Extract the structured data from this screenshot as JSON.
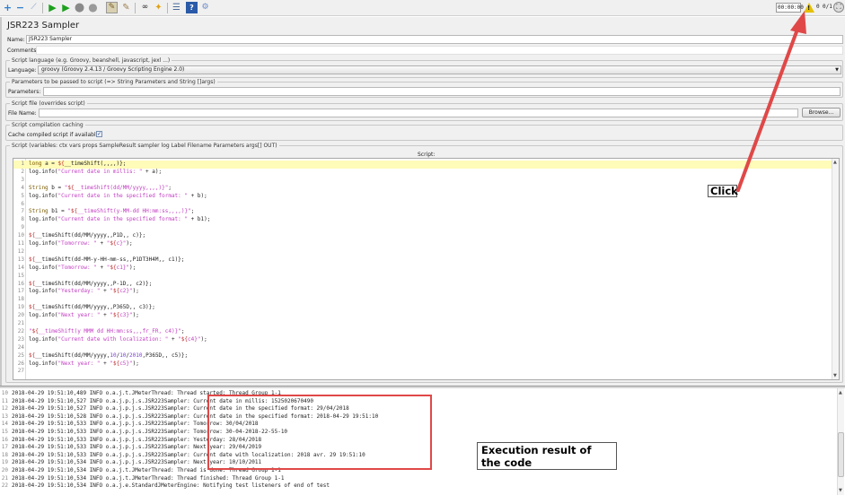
{
  "toolbar": {
    "icons": [
      "expand-all-icon",
      "collapse-all-icon",
      "toggle-icon",
      "start-icon",
      "start-no-pauses-icon",
      "stop-icon",
      "shutdown-icon",
      "clear-icon",
      "clear-all-icon",
      "search-icon",
      "reset-search-icon",
      "function-helper-icon",
      "help-icon",
      "remote-icon"
    ],
    "timer": "00:00:00",
    "error_count": "0",
    "threads": "0/1"
  },
  "panel": {
    "title": "JSR223 Sampler",
    "name_label": "Name:",
    "name_value": "JSR223 Sampler",
    "comments_label": "Comments:",
    "comments_value": "",
    "script_language_group": "Script language (e.g. Groovy, beanshell, javascript, jexl ...)",
    "language_label": "Language:",
    "language_value": "groovy     (Groovy 2.4.13 / Groovy Scripting Engine 2.0)",
    "parameters_group": "Parameters to be passed to script (=> String Parameters and String []args)",
    "parameters_label": "Parameters:",
    "parameters_value": "",
    "script_file_group": "Script file (overrides script)",
    "file_name_label": "File Name:",
    "file_name_value": "",
    "browse_label": "Browse...",
    "caching_group": "Script compilation caching",
    "cache_label": "Cache compiled script if available:",
    "cache_checked": true,
    "script_group": "Script (variables: ctx vars props SampleResult sampler log Label Filename Parameters args[] OUT)",
    "script_header": "Script:"
  },
  "script_lines": [
    "long a = ${__timeShift(,,,,)};",
    "log.info(\"Current date in millis: \" + a);",
    "",
    "String b = \"${__timeShift(dd/MM/yyyy,,,,)}\";",
    "log.info(\"Current date in the specified format: \" + b);",
    "",
    "String b1 = \"${__timeShift(y-MM-dd HH:mm:ss,,,,)}\";",
    "log.info(\"Current date in the specified format: \" + b1);",
    "",
    "${__timeShift(dd/MM/yyyy,,P1D,, c)};",
    "log.info(\"Tomorrow: \" + \"${c}\");",
    "",
    "${__timeShift(dd-MM-y-HH-mm-ss,,P1DT3H4M,, c1)};",
    "log.info(\"Tomorrow: \" + \"${c1}\");",
    "",
    "${__timeShift(dd/MM/yyyy,,P-1D,, c2)};",
    "log.info(\"Yesterday: \" + \"${c2}\");",
    "",
    "${__timeShift(dd/MM/yyyy,,P365D,, c3)};",
    "log.info(\"Next year: \" + \"${c3}\");",
    "",
    "\"${__timeShift(y MMM dd HH:mm:ss,,,fr_FR, c4)}\";",
    "log.info(\"Current date with localization: \" + \"${c4}\");",
    "",
    "${__timeShift(dd/MM/yyyy,10/10/2010,P365D,, c5)};",
    "log.info(\"Next year: \" + \"${c5}\");",
    ""
  ],
  "log": [
    {
      "n": "10",
      "text": "2018-04-29 19:51:10,489 INFO o.a.j.t.JMeterThread: Thread started: Thread Group 1-1"
    },
    {
      "n": "11",
      "text": "2018-04-29 19:51:10,527 INFO o.a.j.p.j.s.JSR223Sampler: Current date in millis: 1525020670490"
    },
    {
      "n": "12",
      "text": "2018-04-29 19:51:10,527 INFO o.a.j.p.j.s.JSR223Sampler: Current date in the specified format: 29/04/2018"
    },
    {
      "n": "13",
      "text": "2018-04-29 19:51:10,528 INFO o.a.j.p.j.s.JSR223Sampler: Current date in the specified format: 2018-04-29 19:51:10"
    },
    {
      "n": "14",
      "text": "2018-04-29 19:51:10,533 INFO o.a.j.p.j.s.JSR223Sampler: Tomorrow: 30/04/2018"
    },
    {
      "n": "15",
      "text": "2018-04-29 19:51:10,533 INFO o.a.j.p.j.s.JSR223Sampler: Tomorrow: 30-04-2018-22-55-10"
    },
    {
      "n": "16",
      "text": "2018-04-29 19:51:10,533 INFO o.a.j.p.j.s.JSR223Sampler: Yesterday: 28/04/2018"
    },
    {
      "n": "17",
      "text": "2018-04-29 19:51:10,533 INFO o.a.j.p.j.s.JSR223Sampler: Next year: 29/04/2019"
    },
    {
      "n": "18",
      "text": "2018-04-29 19:51:10,533 INFO o.a.j.p.j.s.JSR223Sampler: Current date with localization: 2018 avr. 29 19:51:10"
    },
    {
      "n": "19",
      "text": "2018-04-29 19:51:10,534 INFO o.a.j.p.j.s.JSR223Sampler: Next year: 10/10/2011"
    },
    {
      "n": "20",
      "text": "2018-04-29 19:51:10,534 INFO o.a.j.t.JMeterThread: Thread is done: Thread Group 1-1"
    },
    {
      "n": "21",
      "text": "2018-04-29 19:51:10,534 INFO o.a.j.t.JMeterThread: Thread finished: Thread Group 1-1"
    },
    {
      "n": "22",
      "text": "2018-04-29 19:51:10,534 INFO o.a.j.e.StandardJMeterEngine: Notifying test listeners of end of test"
    }
  ],
  "annotations": {
    "click_label": "Click",
    "execution_label": "Execution result of the code",
    "arrow_color": "#e04848",
    "box_color": "#e04848"
  }
}
